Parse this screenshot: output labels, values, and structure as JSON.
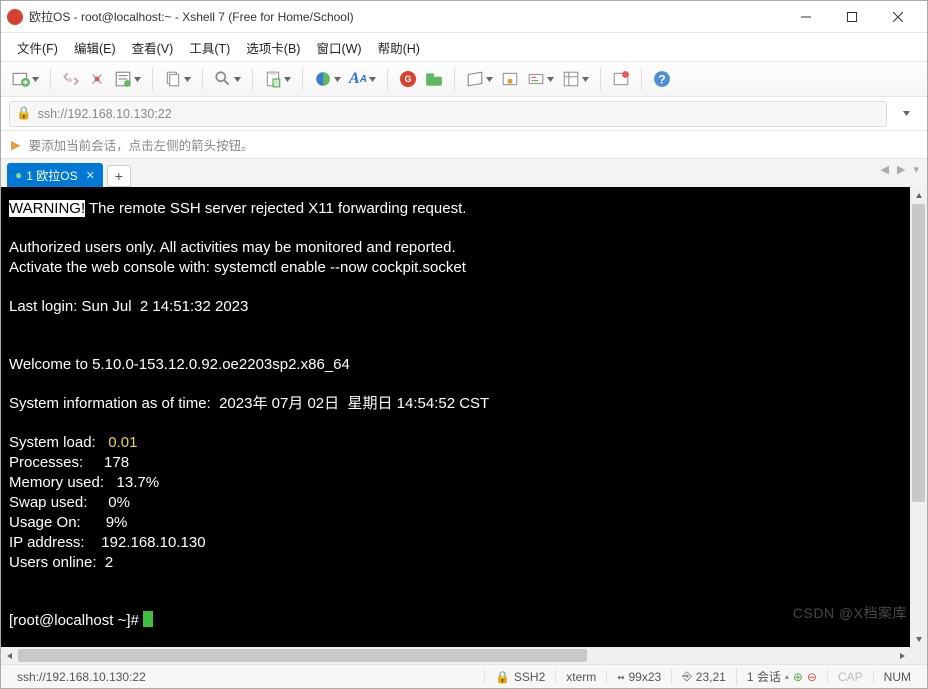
{
  "window": {
    "title": "欧拉OS - root@localhost:~ - Xshell 7 (Free for Home/School)"
  },
  "menu": [
    "文件(F)",
    "编辑(E)",
    "查看(V)",
    "工具(T)",
    "选项卡(B)",
    "窗口(W)",
    "帮助(H)"
  ],
  "address": {
    "url": "ssh://192.168.10.130:22"
  },
  "hint": "要添加当前会话，点击左侧的箭头按钮。",
  "tab": {
    "label": "1 欧拉OS",
    "plus": "+"
  },
  "terminal": {
    "warning_label": "WARNING!",
    "warning_msg": " The remote SSH server rejected X11 forwarding request.",
    "banner1": "Authorized users only. All activities may be monitored and reported.",
    "banner2": "Activate the web console with: systemctl enable --now cockpit.socket",
    "last_login": "Last login: Sun Jul  2 14:51:32 2023",
    "welcome": "Welcome to 5.10.0-153.12.0.92.oe2203sp2.x86_64",
    "sysinfo_time": "System information as of time:  2023年 07月 02日  星期日 14:54:52 CST",
    "rows": {
      "load_label": "System load:   ",
      "load_value": "0.01",
      "proc_label": "Processes:     ",
      "proc_value": "178",
      "mem_label": "Memory used:   ",
      "mem_value": "13.7%",
      "swap_label": "Swap used:     ",
      "swap_value": "0%",
      "usage_label": "Usage On:      ",
      "usage_value": "9%",
      "ip_label": "IP address:    ",
      "ip_value": "192.168.10.130",
      "users_label": "Users online:  ",
      "users_value": "2"
    },
    "prompt": "[root@localhost ~]# "
  },
  "status": {
    "left": "ssh://192.168.10.130:22",
    "proto": "SSH2",
    "term": "xterm",
    "size": "99x23",
    "cursor": "23,21",
    "session": "1 会话",
    "cap": "CAP",
    "num": "NUM"
  },
  "watermark": "CSDN @X档案库"
}
